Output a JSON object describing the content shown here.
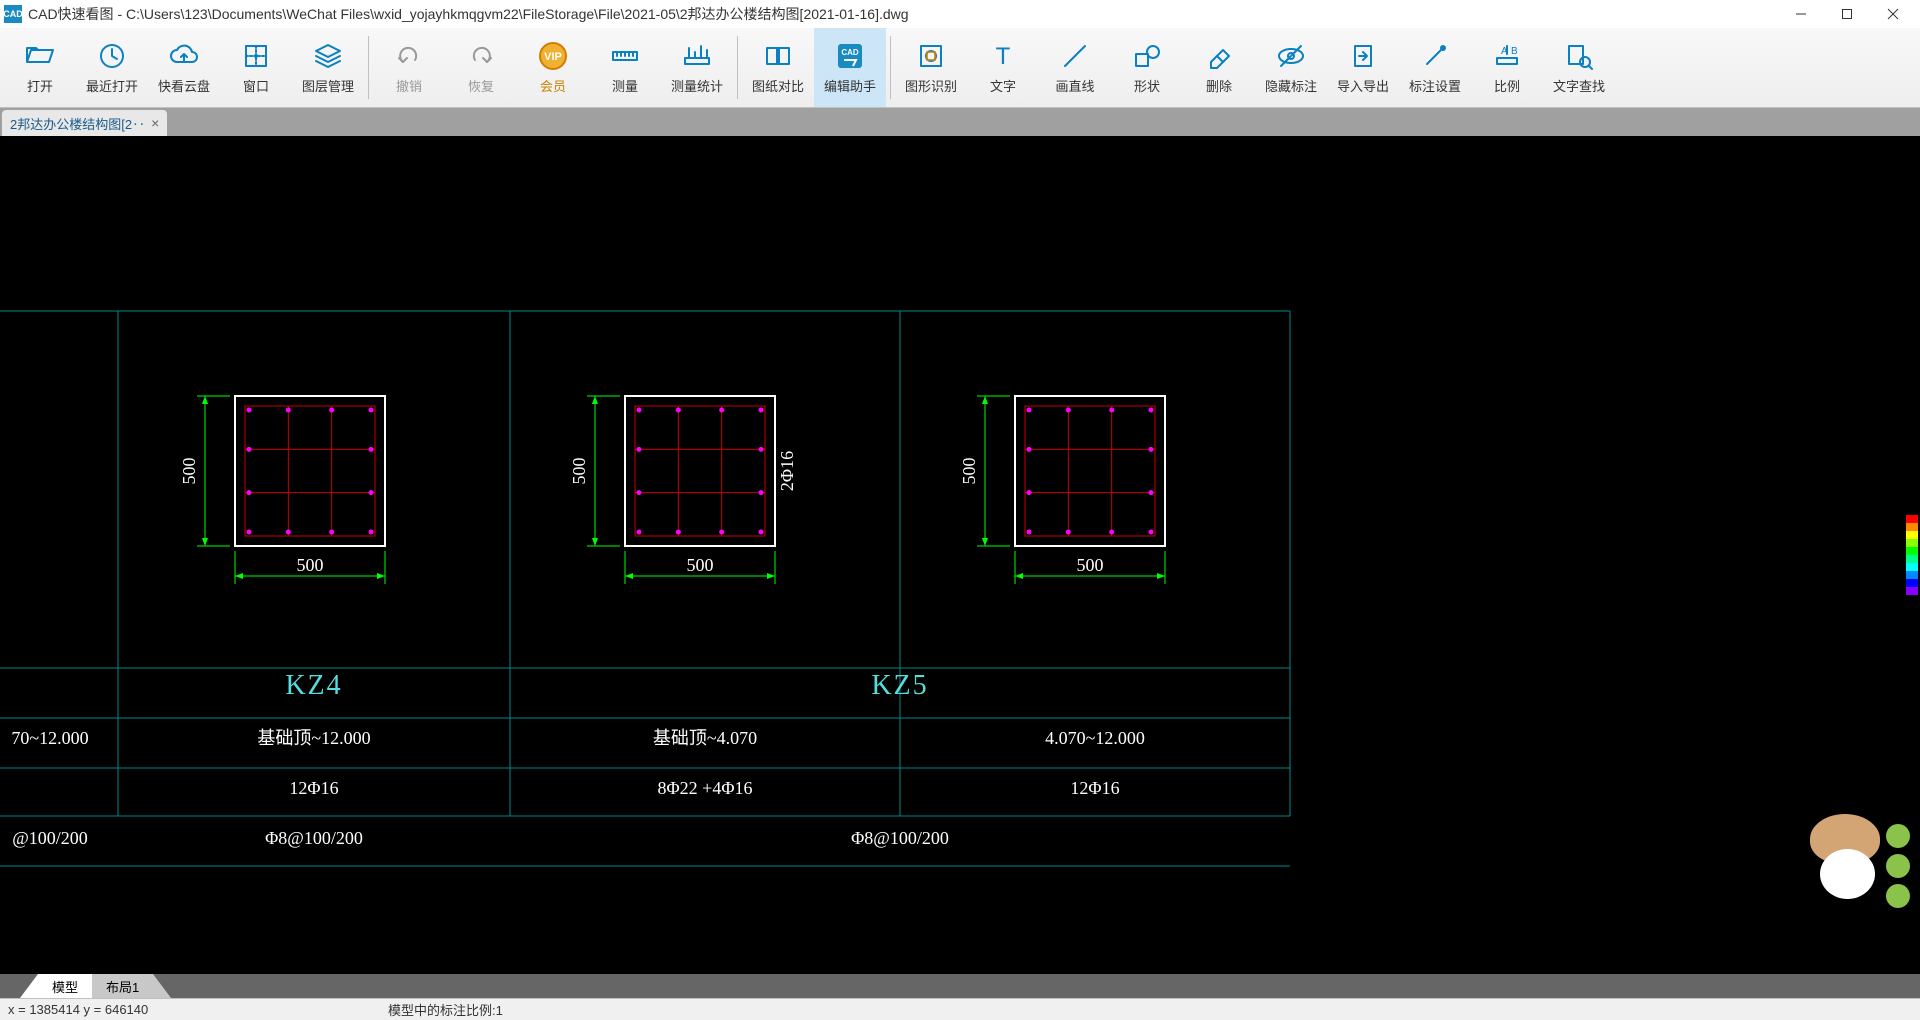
{
  "app": {
    "name": "CAD快速看图",
    "title_path": "C:\\Users\\123\\Documents\\WeChat Files\\wxid_yojayhkmqgvm22\\FileStorage\\File\\2021-05\\2邦达办公楼结构图[2021-01-16].dwg"
  },
  "toolbar": [
    {
      "label": "打开",
      "icon": "folder-open",
      "color": "#0b80c3"
    },
    {
      "label": "最近打开",
      "icon": "clock",
      "color": "#0b80c3"
    },
    {
      "label": "快看云盘",
      "icon": "cloud",
      "color": "#0b80c3"
    },
    {
      "label": "窗口",
      "icon": "window",
      "color": "#0b80c3"
    },
    {
      "label": "图层管理",
      "icon": "layers",
      "color": "#0b80c3"
    },
    {
      "sep": true
    },
    {
      "label": "撤销",
      "icon": "undo",
      "color": "#999",
      "disabled": true
    },
    {
      "label": "恢复",
      "icon": "redo",
      "color": "#999",
      "disabled": true
    },
    {
      "label": "会员",
      "icon": "vip",
      "color": "#d08000",
      "gold": true
    },
    {
      "label": "测量",
      "icon": "ruler",
      "color": "#0b80c3"
    },
    {
      "label": "测量统计",
      "icon": "ruler-stats",
      "color": "#0b80c3"
    },
    {
      "sep": true
    },
    {
      "label": "图纸对比",
      "icon": "compare",
      "color": "#0b80c3"
    },
    {
      "label": "编辑助手",
      "icon": "edit-assist",
      "color": "#0b80c3",
      "active": true
    },
    {
      "sep": true
    },
    {
      "label": "图形识别",
      "icon": "shape-detect",
      "color": "#0b80c3"
    },
    {
      "label": "文字",
      "icon": "text",
      "color": "#0b80c3"
    },
    {
      "label": "画直线",
      "icon": "line",
      "color": "#0b80c3"
    },
    {
      "label": "形状",
      "icon": "shapes",
      "color": "#0b80c3"
    },
    {
      "label": "删除",
      "icon": "eraser",
      "color": "#0b80c3"
    },
    {
      "label": "隐藏标注",
      "icon": "hide-anno",
      "color": "#0b80c3"
    },
    {
      "label": "导入导出",
      "icon": "import-export",
      "color": "#0b80c3"
    },
    {
      "label": "标注设置",
      "icon": "anno-settings",
      "color": "#0b80c3"
    },
    {
      "label": "比例",
      "icon": "scale",
      "color": "#0b80c3"
    },
    {
      "label": "文字查找",
      "icon": "find-text",
      "color": "#0b80c3"
    }
  ],
  "file_tab": "2邦达办公楼结构图[2‥",
  "drawing": {
    "columns": [
      {
        "id": "KZ4",
        "dim_w": "500",
        "dim_h": "500"
      },
      {
        "id": "KZ5",
        "dim_w": "500",
        "dim_h": "500",
        "side_label": "2Φ16"
      },
      {
        "id": "",
        "dim_w": "500",
        "dim_h": "500"
      }
    ],
    "table": {
      "row1_partial": "70~12.000",
      "row1": [
        "基础顶~12.000",
        "基础顶~4.070",
        "4.070~12.000"
      ],
      "row2": [
        "12Φ16",
        "8Φ22 +4Φ16",
        "12Φ16"
      ],
      "row3_partial": "@100/200",
      "row3": [
        "Φ8@100/200",
        "Φ8@100/200"
      ]
    },
    "header_labels": [
      "KZ4",
      "KZ5"
    ]
  },
  "bottom_tabs": [
    "模型",
    "布局1"
  ],
  "status": {
    "coords": "x = 1385414  y = 646140",
    "scale": "模型中的标注比例:1"
  }
}
